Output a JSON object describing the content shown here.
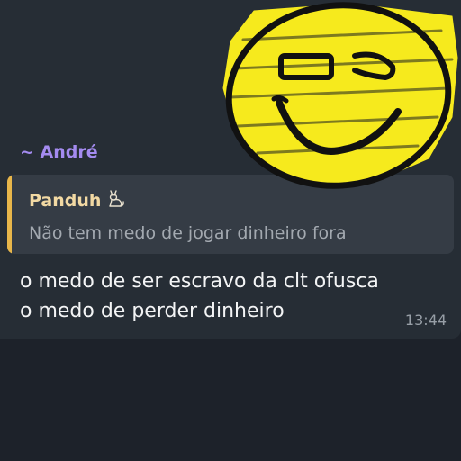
{
  "message": {
    "sender": "~ André",
    "quote": {
      "author": "Panduh",
      "author_emoji": "cat-emoji",
      "text": "Não tem medo de jogar dinheiro fora"
    },
    "lines": [
      "o medo de ser escravo da clt ofusca",
      "o medo de perder dinheiro"
    ],
    "time": "13:44"
  },
  "sticker": {
    "name": "yellow-smiley-scribble-sticker"
  },
  "colors": {
    "background": "#1d222a",
    "bubble": "#262d35",
    "quote_background": "#353c45",
    "quote_accent": "#e8b64a",
    "sender_name": "#a48bf0",
    "sticker_yellow": "#f6ea1d"
  }
}
